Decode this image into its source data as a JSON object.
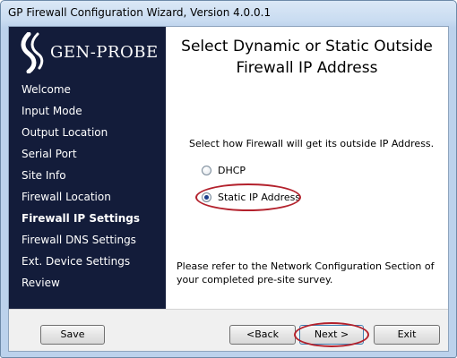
{
  "window": {
    "title": "GP Firewall Configuration Wizard, Version 4.0.0.1"
  },
  "sidebar": {
    "logo_text": "GEN-PROBE",
    "items": [
      {
        "label": "Welcome",
        "active": false
      },
      {
        "label": "Input Mode",
        "active": false
      },
      {
        "label": "Output Location",
        "active": false
      },
      {
        "label": "Serial Port",
        "active": false
      },
      {
        "label": "Site Info",
        "active": false
      },
      {
        "label": "Firewall Location",
        "active": false
      },
      {
        "label": "Firewall IP Settings",
        "active": true
      },
      {
        "label": "Firewall DNS Settings",
        "active": false
      },
      {
        "label": "Ext. Device Settings",
        "active": false
      },
      {
        "label": "Review",
        "active": false
      }
    ]
  },
  "content": {
    "heading_line1": "Select Dynamic or Static Outside",
    "heading_line2": "Firewall IP Address",
    "prompt": "Select how Firewall will get its outside IP Address.",
    "options": [
      {
        "label": "DHCP",
        "checked": false
      },
      {
        "label": "Static IP Address",
        "checked": true
      }
    ],
    "note": "Please refer to the Network Configuration Section of your completed pre-site survey."
  },
  "buttons": {
    "save": "Save",
    "back": "<Back",
    "next": "Next >",
    "exit": "Exit"
  },
  "colors": {
    "sidebar_bg": "#131c3a",
    "highlight": "#b3212c"
  }
}
